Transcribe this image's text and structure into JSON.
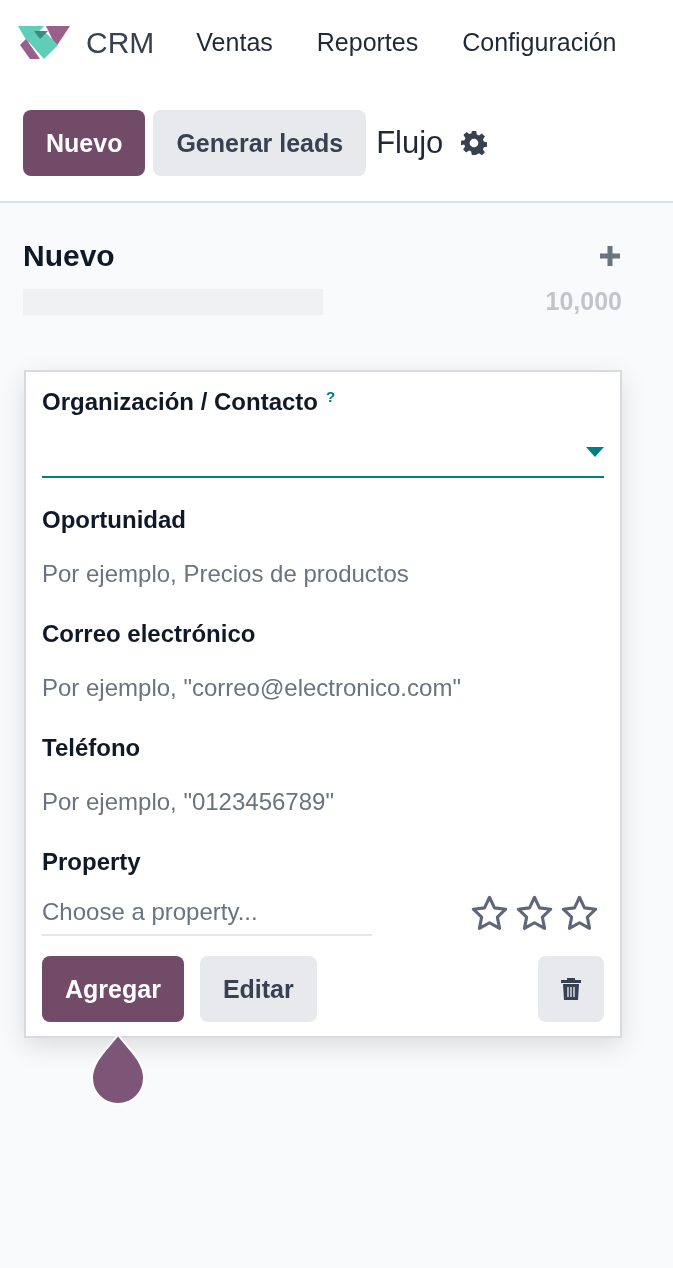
{
  "navbar": {
    "app": "CRM",
    "menu": [
      "Ventas",
      "Reportes",
      "Configuración"
    ]
  },
  "control_panel": {
    "buttons": [
      {
        "label": "Nuevo",
        "kind": "primary"
      },
      {
        "label": "Generar leads",
        "kind": "secondary"
      }
    ],
    "breadcrumb": "Flujo"
  },
  "column": {
    "title": "Nuevo",
    "total": "10,000"
  },
  "quick_create": {
    "fields": [
      {
        "kind": "select",
        "label": "Organización / Contacto",
        "help": "?"
      },
      {
        "kind": "text",
        "label": "Oportunidad",
        "placeholder": "Por ejemplo, Precios de productos"
      },
      {
        "kind": "text",
        "label": "Correo electrónico",
        "placeholder": "Por ejemplo, \"correo@electronico.com\""
      },
      {
        "kind": "text",
        "label": "Teléfono",
        "placeholder": "Por ejemplo, \"0123456789\""
      },
      {
        "kind": "property",
        "label": "Property",
        "placeholder": "Choose a property...",
        "stars": 0
      }
    ],
    "buttons": [
      {
        "label": "Agregar",
        "kind": "primary"
      },
      {
        "label": "Editar",
        "kind": "secondary"
      }
    ]
  }
}
